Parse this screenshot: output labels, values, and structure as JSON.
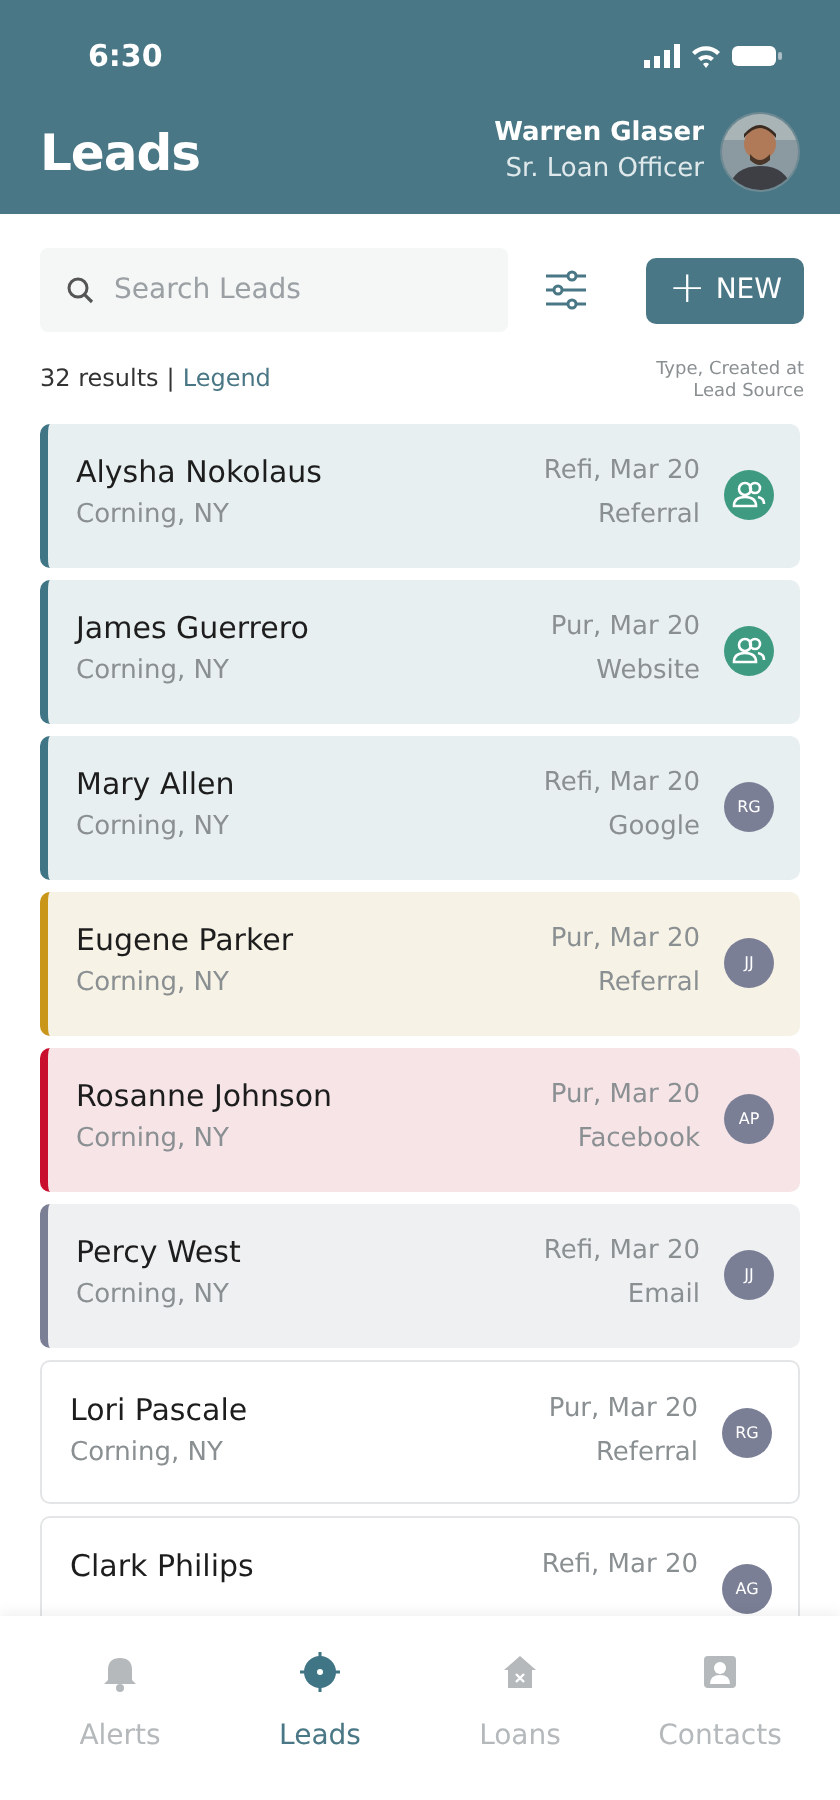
{
  "status_bar": {
    "time": "6:30"
  },
  "header": {
    "title": "Leads",
    "user_name": "Warren Glaser",
    "user_role": "Sr. Loan Officer"
  },
  "search": {
    "placeholder": "Search Leads"
  },
  "new_button": {
    "label": "NEW",
    "icon": "+"
  },
  "summary": {
    "count": "32 results",
    "separator": "|",
    "legend_link": "Legend"
  },
  "column_hint": {
    "line_1": "Type, Created at",
    "line_2": "Lead Source"
  },
  "leads": [
    {
      "name": "Alysha Nokolaus",
      "city": "Corning, NY",
      "type_date": "Refi, Mar 20",
      "source": "Referral",
      "color": "#3f7585",
      "assignee": {
        "kind": "group"
      }
    },
    {
      "name": "James Guerrero",
      "city": "Corning, NY",
      "type_date": "Pur, Mar 20",
      "source": "Website",
      "color": "#3f7585",
      "assignee": {
        "kind": "group"
      }
    },
    {
      "name": "Mary Allen",
      "city": "Corning, NY",
      "type_date": "Refi, Mar 20",
      "source": "Google",
      "color": "#3f7585",
      "assignee": {
        "kind": "initials",
        "text": "RG"
      }
    },
    {
      "name": "Eugene Parker",
      "city": "Corning, NY",
      "type_date": "Pur, Mar 20",
      "source": "Referral",
      "color": "#c9961a",
      "assignee": {
        "kind": "initials",
        "text": "JJ"
      }
    },
    {
      "name": "Rosanne Johnson",
      "city": "Corning, NY",
      "type_date": "Pur, Mar 20",
      "source": "Facebook",
      "color": "#c8102e",
      "assignee": {
        "kind": "initials",
        "text": "AP"
      }
    },
    {
      "name": "Percy West",
      "city": "Corning, NY",
      "type_date": "Refi, Mar 20",
      "source": "Email",
      "color": "#7b7f96",
      "assignee": {
        "kind": "initials",
        "text": "JJ"
      }
    },
    {
      "name": "Lori Pascale",
      "city": "Corning, NY",
      "type_date": "Pur, Mar 20",
      "source": "Referral",
      "assignee": {
        "kind": "initials",
        "text": "RG"
      }
    },
    {
      "name": "Clark Philips",
      "type_date": "Refi, Mar 20",
      "assignee": {
        "kind": "initials",
        "text": "AG"
      }
    }
  ],
  "tabs": [
    {
      "label": "Alerts",
      "kind": "bell",
      "selected": false
    },
    {
      "label": "Leads",
      "kind": "target",
      "selected": true
    },
    {
      "label": "Loans",
      "kind": "house",
      "selected": false
    },
    {
      "label": "Contacts",
      "kind": "contact",
      "selected": false
    }
  ]
}
